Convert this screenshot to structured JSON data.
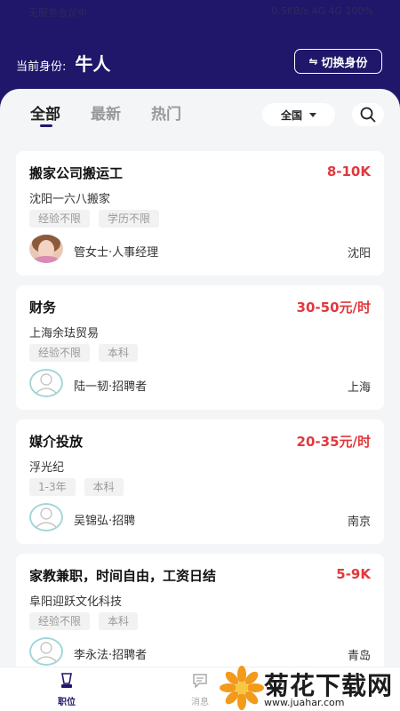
{
  "status_bar": {
    "left": "无服务会议中",
    "right": "0.5KB/s 4G 4G 100%"
  },
  "header": {
    "identity_label": "当前身份:",
    "identity_value": "牛人",
    "switch_icon": "swap-icon",
    "switch_label": "切换身份"
  },
  "tabs": [
    {
      "label": "全部",
      "active": true
    },
    {
      "label": "最新"
    },
    {
      "label": "热门"
    }
  ],
  "region": {
    "label": "全国"
  },
  "jobs": [
    {
      "title": "搬家公司搬运工",
      "salary": "8-10K",
      "company": "沈阳一六八搬家",
      "tags": [
        "经验不限",
        "学历不限"
      ],
      "recruiter": "管女士·人事经理",
      "city": "沈阳",
      "avatar": "photo-avatar"
    },
    {
      "title": "财务",
      "salary": "30-50元/时",
      "company": "上海余珐贸易",
      "tags": [
        "经验不限",
        "本科"
      ],
      "recruiter": "陆一韧·招聘者",
      "city": "上海",
      "avatar": "default-avatar"
    },
    {
      "title": "媒介投放",
      "salary": "20-35元/时",
      "company": "浮光纪",
      "tags": [
        "1-3年",
        "本科"
      ],
      "recruiter": "吴锦弘·招聘",
      "city": "南京",
      "avatar": "default-avatar"
    },
    {
      "title": "家教兼职，时间自由，工资日结",
      "salary": "5-9K",
      "company": "阜阳迎跃文化科技",
      "tags": [
        "经验不限",
        "本科"
      ],
      "recruiter": "李永法·招聘者",
      "city": "青岛",
      "avatar": "default-avatar"
    }
  ],
  "tabbar": [
    {
      "label": "职位",
      "icon": "job-icon",
      "active": true
    },
    {
      "label": "消息",
      "icon": "message-icon"
    }
  ],
  "watermark": {
    "name": "菊花下载网",
    "url": "www.juahar.com"
  },
  "colors": {
    "brand": "#20176a",
    "salary": "#e0393e",
    "background": "#f4f5f7"
  }
}
